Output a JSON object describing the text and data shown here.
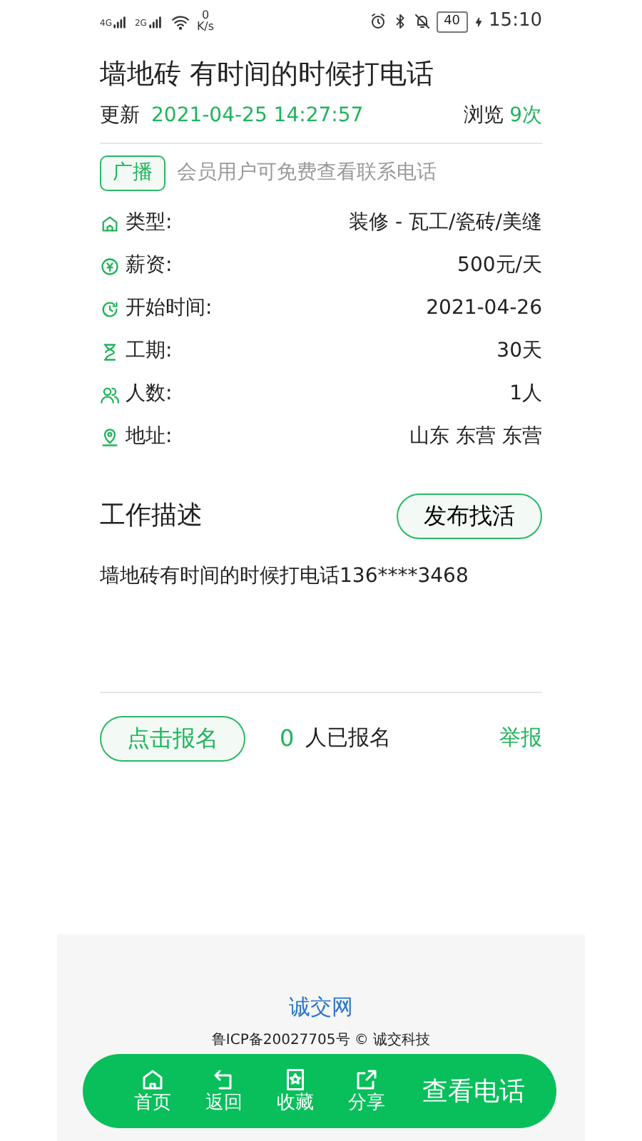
{
  "status_bar": {
    "signal_1": "4G",
    "signal_2": "2G",
    "speed_value": "0",
    "speed_unit": "K/s",
    "battery": "40",
    "time": "15:10"
  },
  "title": "墙地砖 有时间的时候打电话",
  "meta": {
    "updated_label": "更新",
    "updated_value": "2021-04-25 14:27:57",
    "views_label": "浏览",
    "views_value": "9次"
  },
  "notice": {
    "tag": "广播",
    "text": "会员用户可免费查看联系电话"
  },
  "details": [
    {
      "kind": "type",
      "label": "类型:",
      "value": "装修 - 瓦工/瓷砖/美缝"
    },
    {
      "kind": "pay",
      "label": "薪资:",
      "value": "500元/天"
    },
    {
      "kind": "start",
      "label": "开始时间:",
      "value": "2021-04-26"
    },
    {
      "kind": "duration",
      "label": "工期:",
      "value": "30天"
    },
    {
      "kind": "people",
      "label": "人数:",
      "value": "1人"
    },
    {
      "kind": "address",
      "label": "地址:",
      "value": "山东 东营 东营"
    }
  ],
  "description": {
    "heading": "工作描述",
    "button": "发布找活",
    "text": "墙地砖有时间的时候打电话136****3468"
  },
  "signup": {
    "button": "点击报名",
    "count": "0",
    "count_label": "人已报名",
    "report": "举报"
  },
  "footer": {
    "site": "诚交网",
    "icp": "鲁ICP备20027705号 © 诚交科技"
  },
  "bottom_bar": {
    "items": [
      {
        "kind": "home",
        "label": "首页"
      },
      {
        "kind": "back",
        "label": "返回"
      },
      {
        "kind": "favorite",
        "label": "收藏"
      },
      {
        "kind": "share",
        "label": "分享"
      }
    ],
    "call_button": "查看电话"
  }
}
